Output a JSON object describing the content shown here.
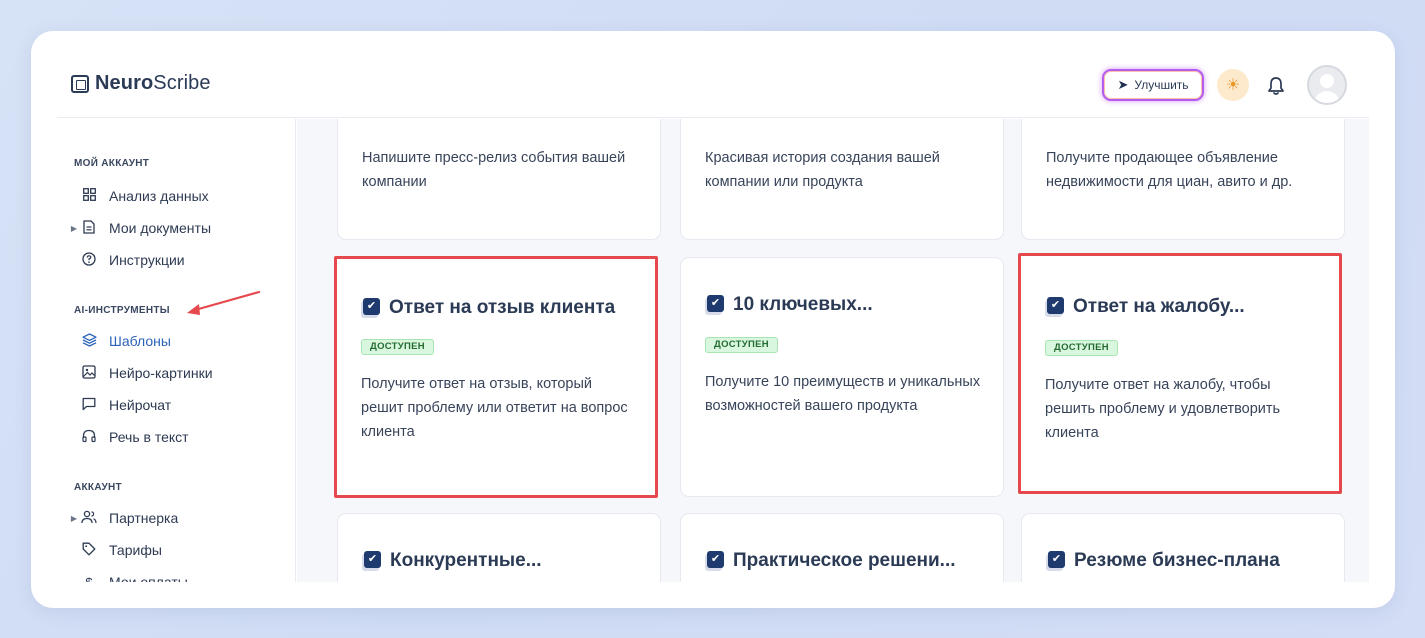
{
  "app": {
    "logo_bold": "Neuro",
    "logo_rest": "Scribe",
    "upgrade_label": "Улучшить"
  },
  "icons": {
    "upgrade": "rocket-icon",
    "theme": "sun-icon",
    "notifications": "bell-icon",
    "user": "avatar"
  },
  "colors": {
    "accent": "#2b63b8",
    "highlight": "#e5484d",
    "badge_bg": "#d9f7de",
    "badge_text": "#246b32",
    "dark": "#2b3a55"
  },
  "sidebar": {
    "section_my_account": "МОЙ АККАУНТ",
    "section_ai_tools": "AI-ИНСТРУМЕНТЫ",
    "section_account": "АККАУНТ",
    "items": [
      {
        "label": "Анализ данных",
        "icon": "grid-icon"
      },
      {
        "label": "Мои документы",
        "icon": "document-icon"
      },
      {
        "label": "Инструкции",
        "icon": "help-circle-icon"
      },
      {
        "label": "Шаблоны",
        "icon": "layers-icon",
        "active": true
      },
      {
        "label": "Нейро-картинки",
        "icon": "image-icon"
      },
      {
        "label": "Нейрочат",
        "icon": "chat-icon"
      },
      {
        "label": "Речь в текст",
        "icon": "headphones-icon"
      },
      {
        "label": "Партнерка",
        "icon": "users-icon"
      },
      {
        "label": "Тарифы",
        "icon": "tag-icon"
      },
      {
        "label": "Мои оплаты",
        "icon": "dollar-icon"
      }
    ]
  },
  "cards": [
    {
      "desc": "Напишите пресс-релиз события вашей компании"
    },
    {
      "desc": "Красивая история создания вашей компании или продукта"
    },
    {
      "desc": "Получите продающее объявление недвижимости для циан, авито и др."
    },
    {
      "title": "Ответ на отзыв клиента",
      "badge": "ДОСТУПЕН",
      "desc": "Получите ответ на отзыв, который решит проблему или ответит на вопрос клиента",
      "highlighted": true
    },
    {
      "title": "10 ключевых...",
      "badge": "ДОСТУПЕН",
      "desc": "Получите 10 преимуществ и уникальных возможностей вашего продукта"
    },
    {
      "title": "Ответ на жалобу...",
      "badge": "ДОСТУПЕН",
      "desc": "Получите ответ на жалобу, чтобы решить проблему и удовлетворить клиента",
      "highlighted": true
    },
    {
      "title": "Конкурентные..."
    },
    {
      "title": "Практическое решени..."
    },
    {
      "title": "Резюме бизнес-плана"
    }
  ]
}
